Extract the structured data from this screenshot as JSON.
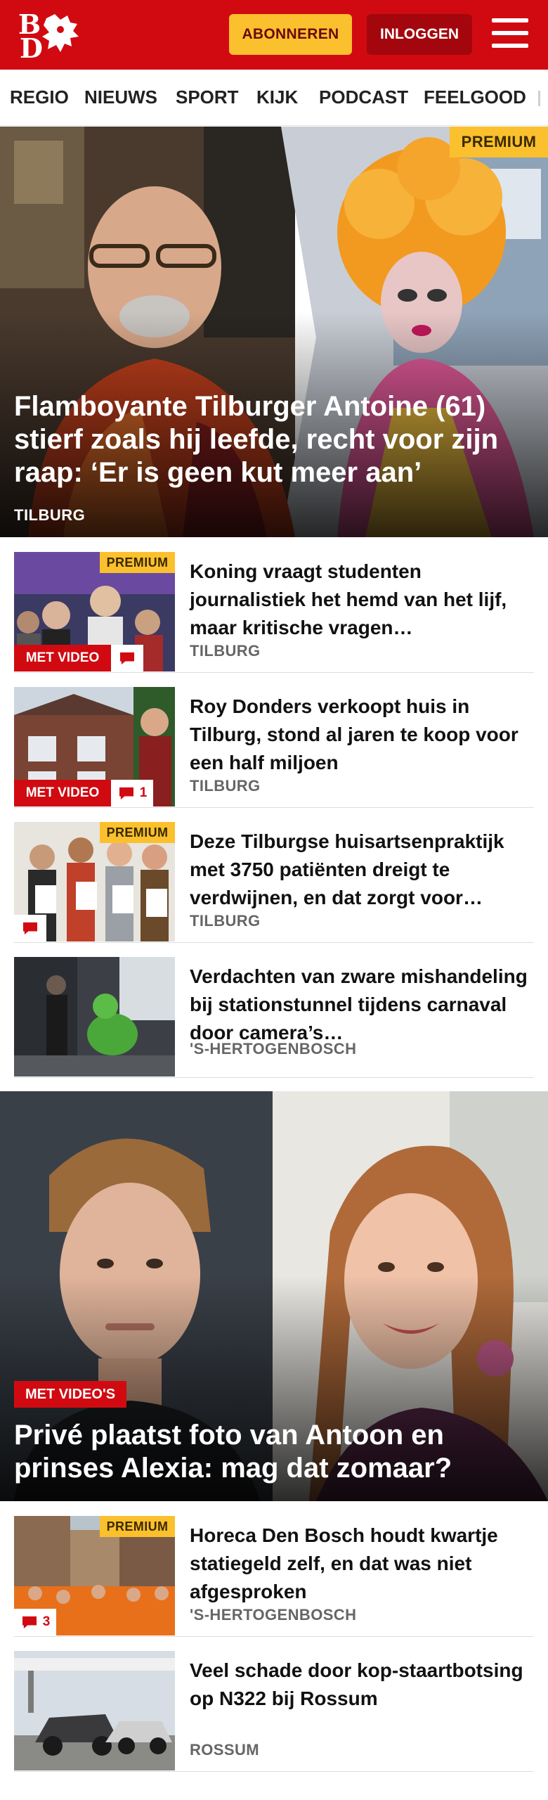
{
  "header": {
    "logo_letters": [
      "B",
      "D"
    ],
    "subscribe_label": "ABONNEREN",
    "login_label": "INLOGGEN"
  },
  "nav": {
    "items": [
      "REGIO",
      "NIEUWS",
      "SPORT",
      "KIJK",
      "PODCAST",
      "FEELGOOD"
    ]
  },
  "hero1": {
    "badge": "PREMIUM",
    "title": "Flamboyante Tilburger Antoine (61) stierf zoals hij leefde, recht voor zijn raap: ‘Er is geen kut meer aan’",
    "tag": "TILBURG"
  },
  "articles": [
    {
      "premium": "PREMIUM",
      "video": "MET VIDEO",
      "comments": "",
      "title": "Koning vraagt studenten journalistiek het hemd van het lijf, maar kritische vragen…",
      "tag": "TILBURG"
    },
    {
      "premium": "",
      "video": "MET VIDEO",
      "comments": "1",
      "title": "Roy Donders verkoopt huis in Tilburg, stond al jaren te koop voor een half miljoen",
      "tag": "TILBURG"
    },
    {
      "premium": "PREMIUM",
      "video": "",
      "comments": "",
      "title": "Deze Tilburgse huisartsenprak­tijk met 3750 patiënten dreigt te verdwijnen, en dat zorgt voor…",
      "tag": "TILBURG"
    },
    {
      "premium": "",
      "video": "",
      "comments": "",
      "title": "Verdachten van zware mishande­ling bij stationstunnel tijdens carnaval door camera’s…",
      "tag": "'S-HERTOGENBOSCH"
    }
  ],
  "hero2": {
    "badge": "MET VIDEO'S",
    "title": "Privé plaatst foto van Antoon en prinses Alexia: mag dat zomaar?"
  },
  "articles2": [
    {
      "premium": "PREMIUM",
      "comments": "3",
      "title": "Horeca Den Bosch houdt kwartje statiegeld zelf, en dat was niet afgesproken",
      "tag": "'S-HERTOGENBOSCH"
    },
    {
      "premium": "",
      "comments": "",
      "title": "Veel schade door kop-staartbot­sing op N322 bij Rossum",
      "tag": "ROSSUM"
    }
  ],
  "icons": {
    "logo": "lion-logo",
    "menu": "hamburger-menu-icon",
    "comment": "comment-bubble-icon"
  },
  "colors": {
    "brand_red": "#d10a11",
    "premium_yellow": "#fbc02d",
    "login_dark_red": "#a3070d"
  }
}
